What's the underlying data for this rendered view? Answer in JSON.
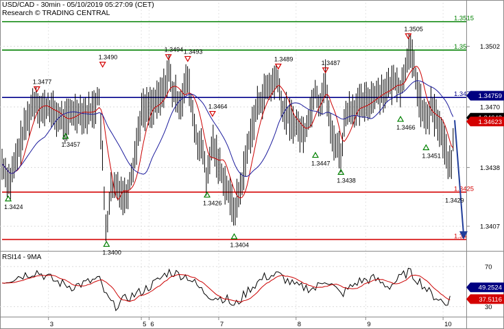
{
  "header": {
    "title": "USD/CAD - 30min - 05/10/2019 05:27:09 (CET)",
    "subtitle": "Research © TRADING CENTRAL"
  },
  "colors": {
    "green": "#008000",
    "red": "#d40000",
    "blue": "#00008b",
    "price": "#000000",
    "ma_red": "#cc0000",
    "ma_blue": "#1a1a9c",
    "arrow": "#1f3c99",
    "current_price_bg": "#000000",
    "blue_price_bg": "#000080",
    "red_price_bg": "#d40000"
  },
  "chart_data": [
    {
      "type": "line",
      "title": "USD/CAD - 30min",
      "y_axis": {
        "ticks": [
          "1.3502",
          "1.3470",
          "1.3438",
          "1.3407"
        ],
        "ylim": [
          1.3394,
          1.3525
        ]
      },
      "x_axis": {
        "labels": [
          "3",
          "5",
          "6",
          "7",
          "8",
          "9",
          "10"
        ],
        "positions": [
          0.6,
          1.8,
          1.9,
          2.8,
          3.8,
          4.7,
          5.7
        ],
        "xlim": [
          0,
          6
        ]
      },
      "levels": [
        {
          "label": "1.3515",
          "value": 1.3515,
          "color": "green"
        },
        {
          "label": "1.35",
          "value": 1.35,
          "color": "green"
        },
        {
          "label": "1.3475",
          "value": 1.3475,
          "color": "blue"
        },
        {
          "label": "1.3425",
          "value": 1.3425,
          "color": "red"
        },
        {
          "label": "1.34",
          "value": 1.34,
          "color": "red"
        }
      ],
      "price_tags": [
        {
          "label": "1.34759",
          "value": 1.34759,
          "color": "blue"
        },
        {
          "label": "1.34643",
          "value": 1.34643,
          "color": "black"
        },
        {
          "label": "1.34623",
          "value": 1.34623,
          "color": "red"
        }
      ],
      "highs": [
        {
          "label": "1.3477",
          "x": 0.45,
          "value": 1.3477
        },
        {
          "label": "1.3490",
          "x": 1.3,
          "value": 1.349
        },
        {
          "label": "1.3494",
          "x": 2.15,
          "value": 1.3494
        },
        {
          "label": "1.3493",
          "x": 2.4,
          "value": 1.3493
        },
        {
          "label": "1.3464",
          "x": 2.72,
          "value": 1.3464
        },
        {
          "label": "1.3489",
          "x": 3.57,
          "value": 1.3489
        },
        {
          "label": "1.3487",
          "x": 4.18,
          "value": 1.3487
        },
        {
          "label": "1.3505",
          "x": 5.25,
          "value": 1.3505
        }
      ],
      "lows": [
        {
          "label": "1.3424",
          "x": 0.08,
          "value": 1.3424
        },
        {
          "label": "1.3457",
          "x": 0.82,
          "value": 1.3457
        },
        {
          "label": "1.3400",
          "x": 1.35,
          "value": 1.34
        },
        {
          "label": "1.3426",
          "x": 2.65,
          "value": 1.3426
        },
        {
          "label": "1.3404",
          "x": 3.0,
          "value": 1.3404
        },
        {
          "label": "1.3447",
          "x": 4.05,
          "value": 1.3447
        },
        {
          "label": "1.3438",
          "x": 4.38,
          "value": 1.3438
        },
        {
          "label": "1.3466",
          "x": 5.15,
          "value": 1.3466
        },
        {
          "label": "1.3451",
          "x": 5.48,
          "value": 1.3451
        }
      ],
      "target_label": "1.3429",
      "forecast": {
        "from": [
          5.85,
          1.3463
        ],
        "to": [
          6.0,
          1.34
        ]
      },
      "price_x": [
        0.0,
        0.1,
        0.2,
        0.3,
        0.4,
        0.45,
        0.5,
        0.6,
        0.7,
        0.82,
        0.9,
        1.0,
        1.1,
        1.2,
        1.25,
        1.3,
        1.33,
        1.35,
        1.4,
        1.5,
        1.6,
        1.7,
        1.8,
        1.9,
        2.0,
        2.1,
        2.15,
        2.2,
        2.3,
        2.4,
        2.5,
        2.6,
        2.65,
        2.72,
        2.8,
        2.9,
        3.0,
        3.1,
        3.2,
        3.3,
        3.4,
        3.5,
        3.57,
        3.6,
        3.7,
        3.8,
        3.9,
        4.0,
        4.05,
        4.1,
        4.18,
        4.25,
        4.3,
        4.38,
        4.45,
        4.6,
        4.7,
        4.8,
        4.9,
        5.0,
        5.1,
        5.15,
        5.2,
        5.25,
        5.3,
        5.35,
        5.4,
        5.48,
        5.55,
        5.65,
        5.75,
        5.8,
        5.85
      ],
      "price_y": [
        1.344,
        1.343,
        1.3445,
        1.346,
        1.3472,
        1.3474,
        1.3468,
        1.347,
        1.3465,
        1.3462,
        1.3467,
        1.3468,
        1.3466,
        1.347,
        1.3478,
        1.344,
        1.341,
        1.3405,
        1.3425,
        1.3428,
        1.3422,
        1.344,
        1.3468,
        1.347,
        1.3472,
        1.348,
        1.349,
        1.3478,
        1.3472,
        1.3485,
        1.3455,
        1.3445,
        1.343,
        1.3452,
        1.344,
        1.3428,
        1.3415,
        1.343,
        1.3455,
        1.347,
        1.3478,
        1.3482,
        1.3486,
        1.347,
        1.3465,
        1.346,
        1.3455,
        1.347,
        1.348,
        1.347,
        1.3484,
        1.3455,
        1.3452,
        1.3445,
        1.3468,
        1.347,
        1.3472,
        1.3476,
        1.3478,
        1.348,
        1.3485,
        1.3478,
        1.3488,
        1.35,
        1.3495,
        1.3485,
        1.3472,
        1.3462,
        1.347,
        1.346,
        1.3445,
        1.3435,
        1.3463
      ]
    },
    {
      "type": "line",
      "title": "RSI14 - 9MA",
      "y_axis": {
        "ticks": [
          "70",
          "30"
        ],
        "ylim": [
          20,
          85
        ]
      },
      "value_tags": [
        {
          "label": "49.2524",
          "value": 49.2524,
          "color": "blue"
        },
        {
          "label": "37.5116",
          "value": 37.5116,
          "color": "red"
        }
      ],
      "rsi_x": [
        0.0,
        0.2,
        0.45,
        0.7,
        0.9,
        1.1,
        1.25,
        1.35,
        1.45,
        1.6,
        1.8,
        2.0,
        2.15,
        2.4,
        2.6,
        2.72,
        2.9,
        3.0,
        3.2,
        3.4,
        3.57,
        3.8,
        4.05,
        4.18,
        4.38,
        4.6,
        4.8,
        5.0,
        5.25,
        5.4,
        5.55,
        5.65,
        5.75,
        5.8
      ],
      "rsi_y": [
        55,
        60,
        65,
        55,
        50,
        54,
        58,
        40,
        30,
        38,
        45,
        55,
        65,
        60,
        45,
        40,
        38,
        30,
        48,
        60,
        62,
        50,
        48,
        58,
        42,
        55,
        58,
        50,
        65,
        55,
        42,
        38,
        30,
        49
      ]
    }
  ]
}
